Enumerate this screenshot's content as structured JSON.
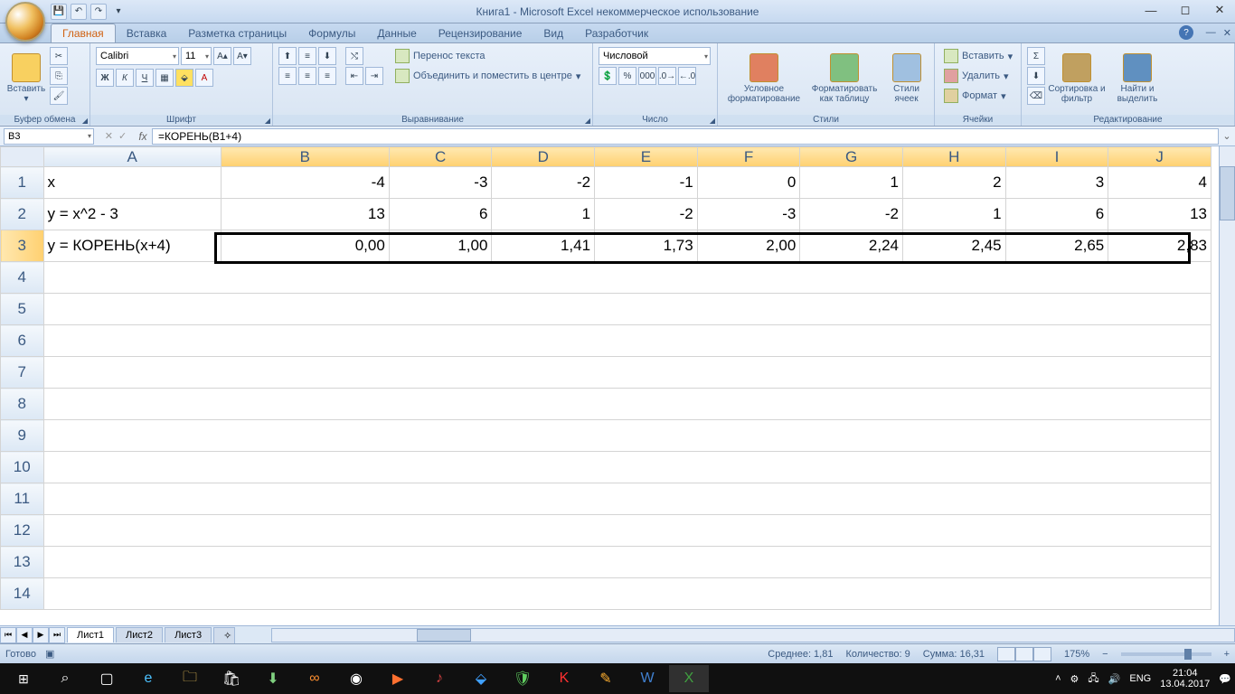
{
  "title": "Книга1 - Microsoft Excel некоммерческое использование",
  "tabs": [
    "Главная",
    "Вставка",
    "Разметка страницы",
    "Формулы",
    "Данные",
    "Рецензирование",
    "Вид",
    "Разработчик"
  ],
  "active_tab": 0,
  "ribbon": {
    "clipboard": {
      "label": "Буфер обмена",
      "paste": "Вставить"
    },
    "font": {
      "label": "Шрифт",
      "family": "Calibri",
      "size": "11"
    },
    "alignment": {
      "label": "Выравнивание",
      "wrap": "Перенос текста",
      "merge": "Объединить и поместить в центре"
    },
    "number": {
      "label": "Число",
      "format": "Числовой"
    },
    "styles": {
      "label": "Стили",
      "cond": "Условное форматирование",
      "table": "Форматировать как таблицу",
      "cell": "Стили ячеек"
    },
    "cells": {
      "label": "Ячейки",
      "insert": "Вставить",
      "delete": "Удалить",
      "format": "Формат"
    },
    "editing": {
      "label": "Редактирование",
      "sort": "Сортировка и фильтр",
      "find": "Найти и выделить"
    }
  },
  "name_box": "B3",
  "formula": "=КОРЕНЬ(B1+4)",
  "columns": [
    "A",
    "B",
    "C",
    "D",
    "E",
    "F",
    "G",
    "H",
    "I",
    "J"
  ],
  "rows": [
    "1",
    "2",
    "3",
    "4",
    "5",
    "6",
    "7",
    "8",
    "9",
    "10",
    "11",
    "12",
    "13",
    "14"
  ],
  "cells": {
    "r1": {
      "A": "x",
      "B": "-4",
      "C": "-3",
      "D": "-2",
      "E": "-1",
      "F": "0",
      "G": "1",
      "H": "2",
      "I": "3",
      "J": "4"
    },
    "r2": {
      "A": "y = x^2 - 3",
      "B": "13",
      "C": "6",
      "D": "1",
      "E": "-2",
      "F": "-3",
      "G": "-2",
      "H": "1",
      "I": "6",
      "J": "13"
    },
    "r3": {
      "A": "y = КОРЕНЬ(x+4)",
      "B": "0,00",
      "C": "1,00",
      "D": "1,41",
      "E": "1,73",
      "F": "2,00",
      "G": "2,24",
      "H": "2,45",
      "I": "2,65",
      "J": "2,83"
    }
  },
  "sheets": [
    "Лист1",
    "Лист2",
    "Лист3"
  ],
  "status": {
    "ready": "Готово",
    "avg": "Среднее: 1,81",
    "count": "Количество: 9",
    "sum": "Сумма: 16,31",
    "zoom": "175%"
  },
  "taskbar": {
    "lang": "ENG",
    "time": "21:04",
    "date": "13.04.2017"
  }
}
